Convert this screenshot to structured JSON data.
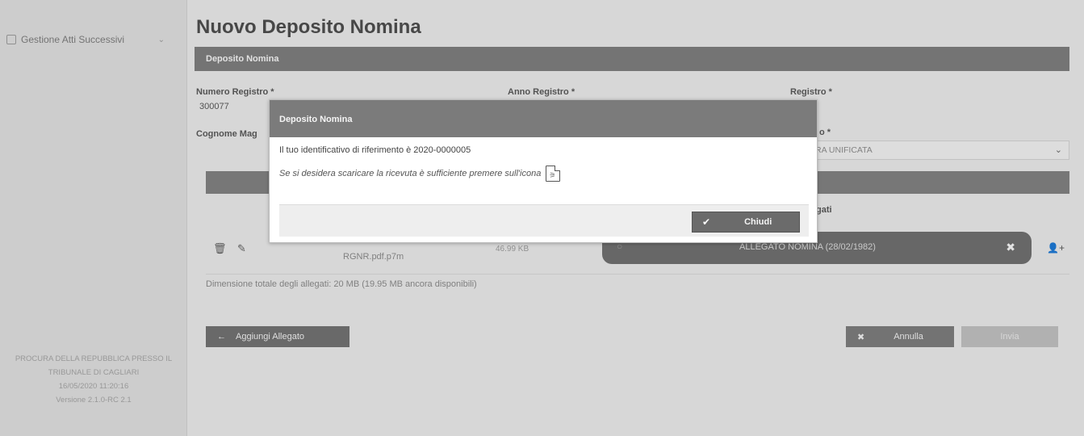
{
  "sidebar": {
    "nav_label": "Gestione Atti Successivi",
    "footer_logo": "",
    "footer_lines": [
      "PROCURA DELLA REPUBBLICA PRESSO IL",
      "TRIBUNALE DI CAGLIARI",
      "16/05/2020 11:20:16",
      "Versione 2.1.0-RC 2.1"
    ]
  },
  "page": {
    "title": "Nuovo Deposito Nomina",
    "section_title": "Deposito Nomina"
  },
  "form": {
    "numero_registro_label": "Numero Registro *",
    "numero_registro_value": "300077",
    "anno_registro_label": "Anno Registro *",
    "registro_label": "Registro *",
    "cognome_label": "Cognome Mag",
    "select_label_suffix": "o *",
    "select_value": "RA UNIFICATA"
  },
  "attachments": {
    "header_allegati": "gati",
    "file_name": "RGNR.pdf.p7m",
    "file_size": "46.99 KB",
    "tag_text": "ALLEGATO NOMINA (28/02/1982)",
    "size_note": "Dimensione totale degli allegati: 20 MB (19.95 MB ancora disponibili)"
  },
  "buttons": {
    "add_label": "Aggiungi Allegato",
    "annulla_label": "Annulla",
    "invia_label": "Invia"
  },
  "modal": {
    "title": "Deposito Nomina",
    "line1": "Il tuo identificativo di riferimento è 2020-0000005",
    "line2": "Se si desidera scaricare la ricevuta è sufficiente premere sull'icona",
    "close_label": "Chiudi"
  },
  "icons": {
    "nav": "folder-icon",
    "pdf": "pdf-icon",
    "trash": "trash-icon",
    "edit": "pencil-icon",
    "check": "check-icon",
    "close": "close-icon",
    "add_user": "add-user-icon"
  }
}
